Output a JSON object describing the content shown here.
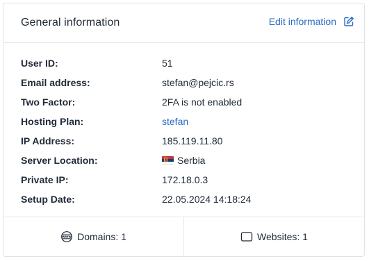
{
  "header": {
    "title": "General information",
    "edit_label": "Edit information",
    "edit_icon": "edit-square-icon"
  },
  "info": [
    {
      "label": "User ID:",
      "value": "51"
    },
    {
      "label": "Email address:",
      "value": "stefan@pejcic.rs"
    },
    {
      "label": "Two Factor:",
      "value": "2FA is not enabled"
    },
    {
      "label": "Hosting Plan:",
      "value": "stefan"
    },
    {
      "label": "IP Address:",
      "value": "185.119.11.80"
    },
    {
      "label": "Server Location:",
      "value": "Serbia",
      "flag": "serbia-flag-icon"
    },
    {
      "label": "Private IP:",
      "value": "172.18.0.3"
    },
    {
      "label": "Setup Date:",
      "value": "22.05.2024 14:18:24"
    }
  ],
  "footer": {
    "domains_label": "Domains: 1",
    "domains_icon": "www-globe-icon",
    "websites_label": "Websites: 1",
    "websites_icon": "browser-window-icon"
  },
  "colors": {
    "accent_link": "#2a6cc4",
    "text": "#1f2937",
    "border": "#e3e6ea"
  }
}
